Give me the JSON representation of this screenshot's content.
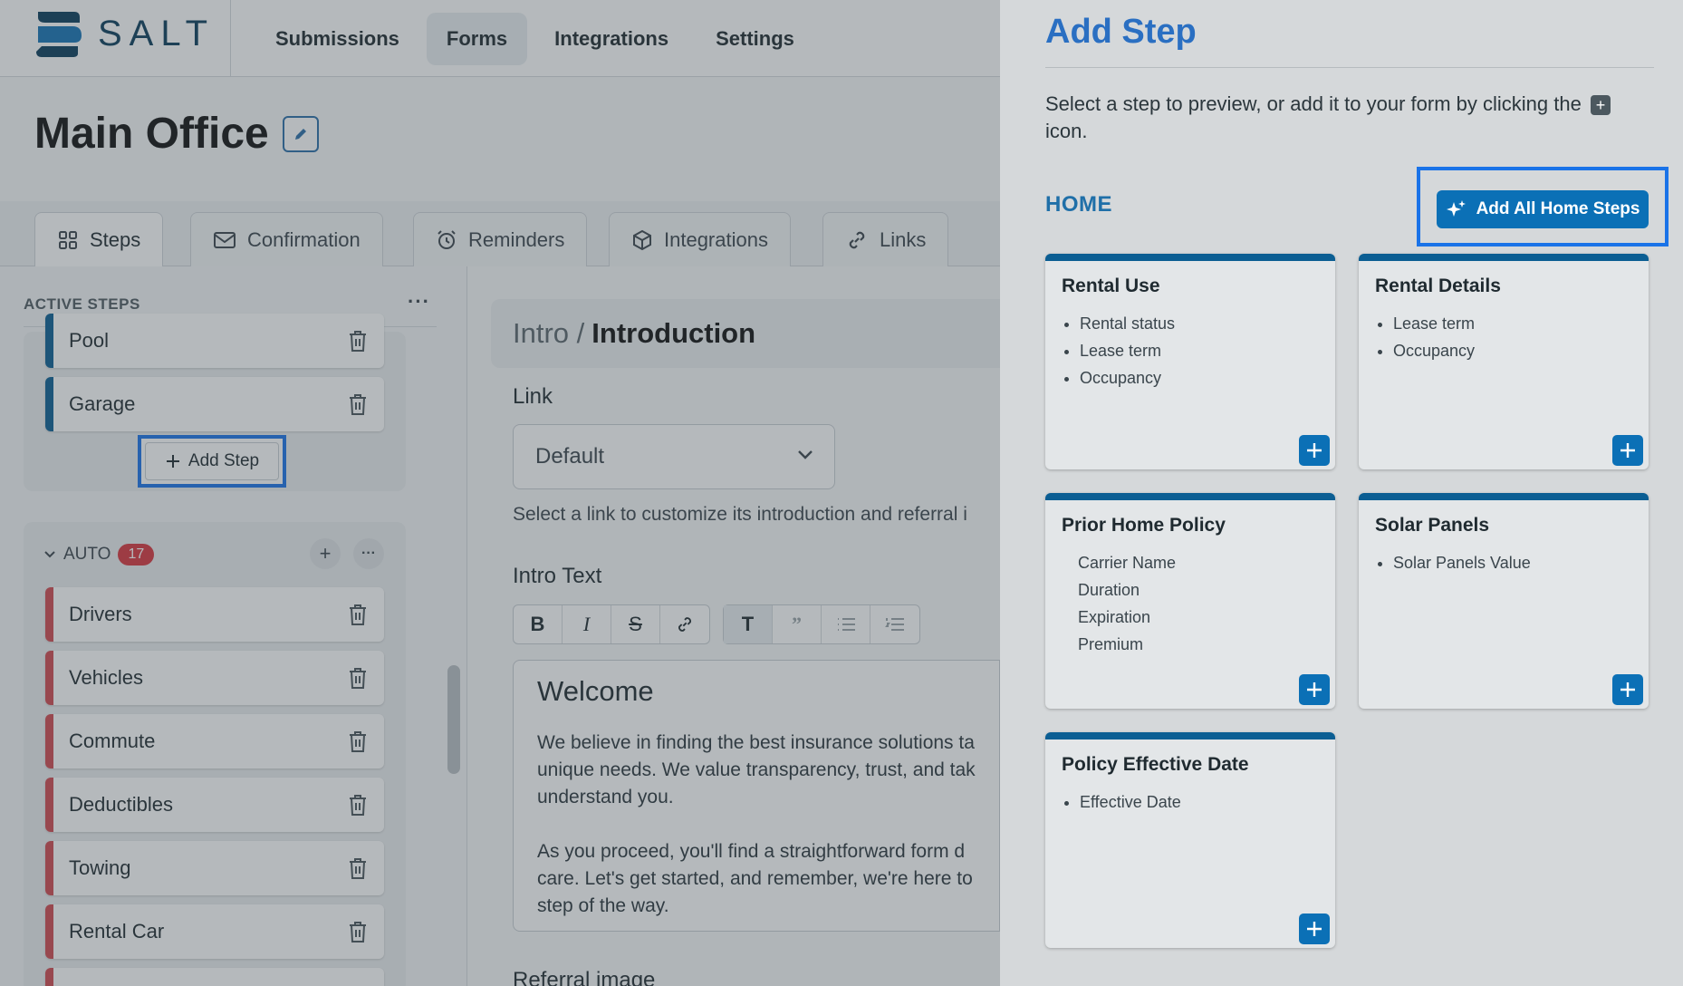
{
  "brand": {
    "name": "SALT"
  },
  "topnav": {
    "items": [
      "Submissions",
      "Forms",
      "Integrations",
      "Settings"
    ],
    "active": "Forms"
  },
  "page": {
    "title": "Main Office"
  },
  "tabs": [
    {
      "label": "Steps",
      "icon": "grid-icon"
    },
    {
      "label": "Confirmation",
      "icon": "envelope-icon"
    },
    {
      "label": "Reminders",
      "icon": "alarm-clock-icon"
    },
    {
      "label": "Integrations",
      "icon": "cube-icon"
    },
    {
      "label": "Links",
      "icon": "link-icon"
    }
  ],
  "sidebar": {
    "active_steps_label": "ACTIVE STEPS",
    "home_steps": [
      "Pool",
      "Garage"
    ],
    "add_step_label": "Add Step",
    "auto_group": {
      "label": "AUTO",
      "count": "17"
    },
    "auto_steps": [
      "Drivers",
      "Vehicles",
      "Commute",
      "Deductibles",
      "Towing",
      "Rental Car"
    ]
  },
  "editor": {
    "breadcrumb_parent": "Intro /",
    "breadcrumb_current": "Introduction",
    "link_label": "Link",
    "link_value": "Default",
    "link_helper": "Select a link to customize its introduction and referral i",
    "intro_text_label": "Intro Text",
    "heading": "Welcome",
    "paragraph1_lines": [
      "We believe in finding the best insurance solutions ta",
      "unique needs. We value transparency, trust, and tak",
      "understand you."
    ],
    "paragraph2_lines": [
      "As you proceed, you'll find a straightforward form d",
      "care. Let's get started, and remember, we're here to",
      "step of the way."
    ],
    "referral_label": "Referral image"
  },
  "panel": {
    "title": "Add Step",
    "description_before": "Select a step to preview, or add it to your form by clicking the",
    "description_after": "icon.",
    "section_label": "HOME",
    "add_all_label": "Add All Home Steps",
    "cards": [
      {
        "title": "Rental Use",
        "items": [
          "Rental status",
          "Lease term",
          "Occupancy"
        ],
        "bulleted": true
      },
      {
        "title": "Rental Details",
        "items": [
          "Lease term",
          "Occupancy"
        ],
        "bulleted": true
      },
      {
        "title": "Prior Home Policy",
        "items": [
          "Carrier Name",
          "Duration",
          "Expiration",
          "Premium"
        ],
        "bulleted": false
      },
      {
        "title": "Solar Panels",
        "items": [
          "Solar Panels Value"
        ],
        "bulleted": true
      },
      {
        "title": "Policy Effective Date",
        "items": [
          "Effective Date"
        ],
        "bulleted": true
      }
    ]
  },
  "colors": {
    "accent": "#0b70b6",
    "highlight": "#1a73e8",
    "title_blue": "#2a6fc2",
    "home_bar": "#0b5e93",
    "auto_bar": "#d04a50",
    "badge": "#d9363e"
  }
}
